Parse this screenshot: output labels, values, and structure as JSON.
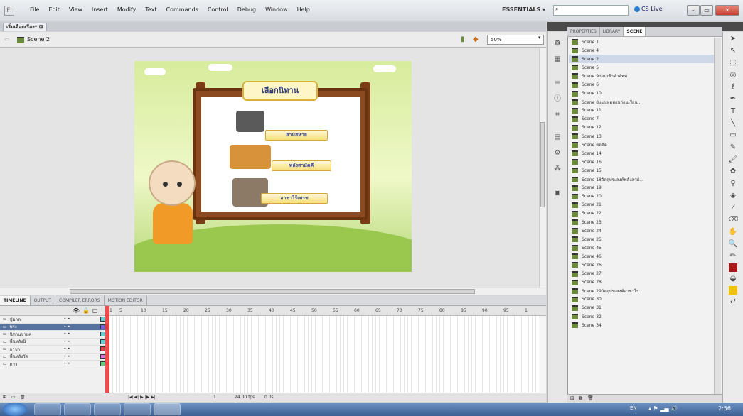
{
  "menubar": {
    "items": [
      "File",
      "Edit",
      "View",
      "Insert",
      "Modify",
      "Text",
      "Commands",
      "Control",
      "Debug",
      "Window",
      "Help"
    ],
    "workspace": "ESSENTIALS ▾",
    "search_placeholder": "",
    "cslive": "CS Live"
  },
  "document": {
    "tab": "เริ่มเลือกเรื่อง*"
  },
  "editbar": {
    "scene": "Scene 2",
    "zoom": "50%"
  },
  "stage": {
    "title": "เลือกนิทาน",
    "tales": [
      "สามสหาย",
      "พลังสามัคคี",
      "อาชาไร้เพรช"
    ]
  },
  "panel": {
    "tabs": [
      "PROPERTIES",
      "LIBRARY",
      "SCENE"
    ],
    "scenes": [
      "Scene 1",
      "Scene 4",
      "Scene 2",
      "Scene 5",
      "Scene 9ก่อนเข้าคำศัพท์",
      "Scene 6",
      "Scene 10",
      "Scene 8แบบทดสอบก่อนเรียน...",
      "Scene 11",
      "Scene 7",
      "Scene 12",
      "Scene 13",
      "Scene ข้อคิด",
      "Scene 14",
      "Scene 16",
      "Scene 15",
      "Scene 18วัตถุประสงค์พลังสามั...",
      "Scene 19",
      "Scene 20",
      "Scene 21",
      "Scene 22",
      "Scene 23",
      "Scene 24",
      "Scene 25",
      "Scene 45",
      "Scene 46",
      "Scene 26",
      "Scene 27",
      "Scene 28",
      "Scene 29วัตถุประสงค์อาชาไร...",
      "Scene 30",
      "Scene 31",
      "Scene 32",
      "Scene 34"
    ],
    "selected_index": 2
  },
  "timeline": {
    "tabs": [
      "TIMELINE",
      "OUTPUT",
      "COMPILER ERRORS",
      "MOTION EDITOR"
    ],
    "frame_numbers": [
      "1",
      "5",
      "10",
      "15",
      "20",
      "25",
      "30",
      "35",
      "40",
      "45",
      "50",
      "55",
      "60",
      "65",
      "70",
      "75",
      "80",
      "85",
      "90",
      "95",
      "1"
    ],
    "layers": [
      {
        "name": "ปุ่มกด",
        "color": "#5fd0d8"
      },
      {
        "name": "พระ",
        "color": "#7b5fd8"
      },
      {
        "name": "นิทานข่ายค",
        "color": "#5fd0d8"
      },
      {
        "name": "พื้นหลังนิ",
        "color": "#5fd0d8"
      },
      {
        "name": "อาชา",
        "color": "#e23b3b"
      },
      {
        "name": "พื้นหลังวัด",
        "color": "#e86be0"
      },
      {
        "name": "ดาว",
        "color": "#5fd07a"
      }
    ],
    "selected_layer": 1,
    "fps": "24.00 fps",
    "time": "0.0s",
    "frame": "1"
  },
  "taskbar": {
    "lang": "EN",
    "clock": "2:56"
  }
}
